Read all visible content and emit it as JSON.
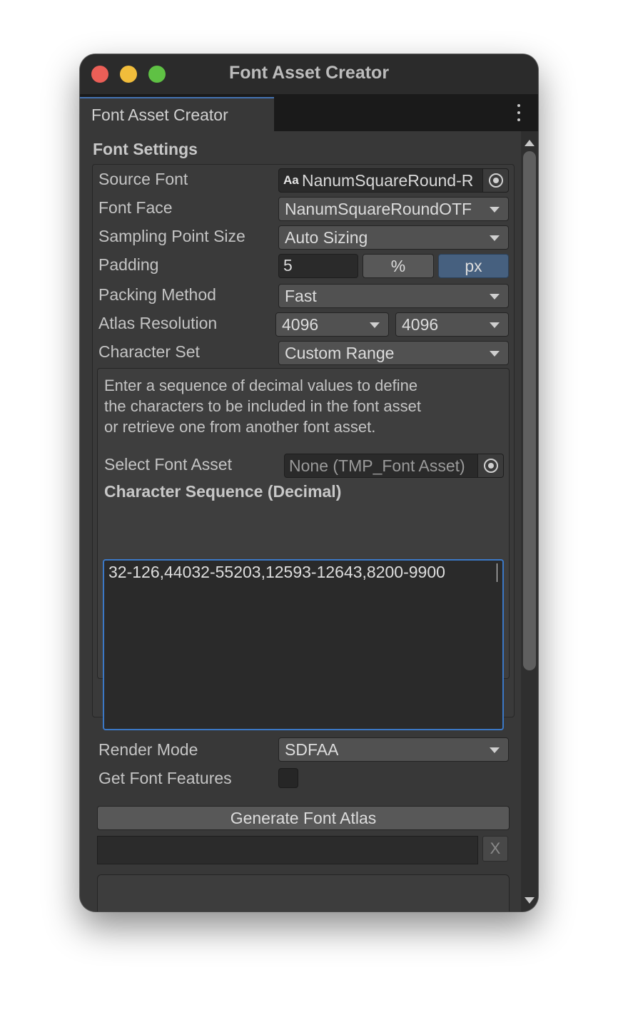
{
  "window": {
    "title": "Font Asset Creator"
  },
  "tab": {
    "label": "Font Asset Creator"
  },
  "section": {
    "heading": "Font Settings"
  },
  "fields": {
    "source_font": {
      "label": "Source Font",
      "icon_text": "Aa",
      "value": "NanumSquareRound-R"
    },
    "font_face": {
      "label": "Font Face",
      "value": "NanumSquareRoundOTF"
    },
    "sampling_point_size": {
      "label": "Sampling Point Size",
      "value": "Auto Sizing"
    },
    "padding": {
      "label": "Padding",
      "value": "5",
      "percent_label": "%",
      "px_label": "px",
      "selected_unit": "px"
    },
    "packing_method": {
      "label": "Packing Method",
      "value": "Fast"
    },
    "atlas_resolution": {
      "label": "Atlas Resolution",
      "width": "4096",
      "height": "4096"
    },
    "character_set": {
      "label": "Character Set",
      "value": "Custom Range"
    }
  },
  "custom_range": {
    "help_lines": [
      "Enter a sequence of decimal values to define",
      "the characters to be included in the font asset",
      "or retrieve one from another font asset."
    ],
    "select_font_asset": {
      "label": "Select Font Asset",
      "value": "None (TMP_Font Asset)"
    },
    "sequence_heading": "Character Sequence (Decimal)",
    "sequence_value": "32-126,44032-55203,12593-12643,8200-9900"
  },
  "render_mode": {
    "label": "Render Mode",
    "value": "SDFAA"
  },
  "font_features": {
    "label": "Get Font Features",
    "checked": false
  },
  "generate_button": {
    "label": "Generate Font Atlas"
  },
  "clear_button": {
    "label": "X"
  }
}
